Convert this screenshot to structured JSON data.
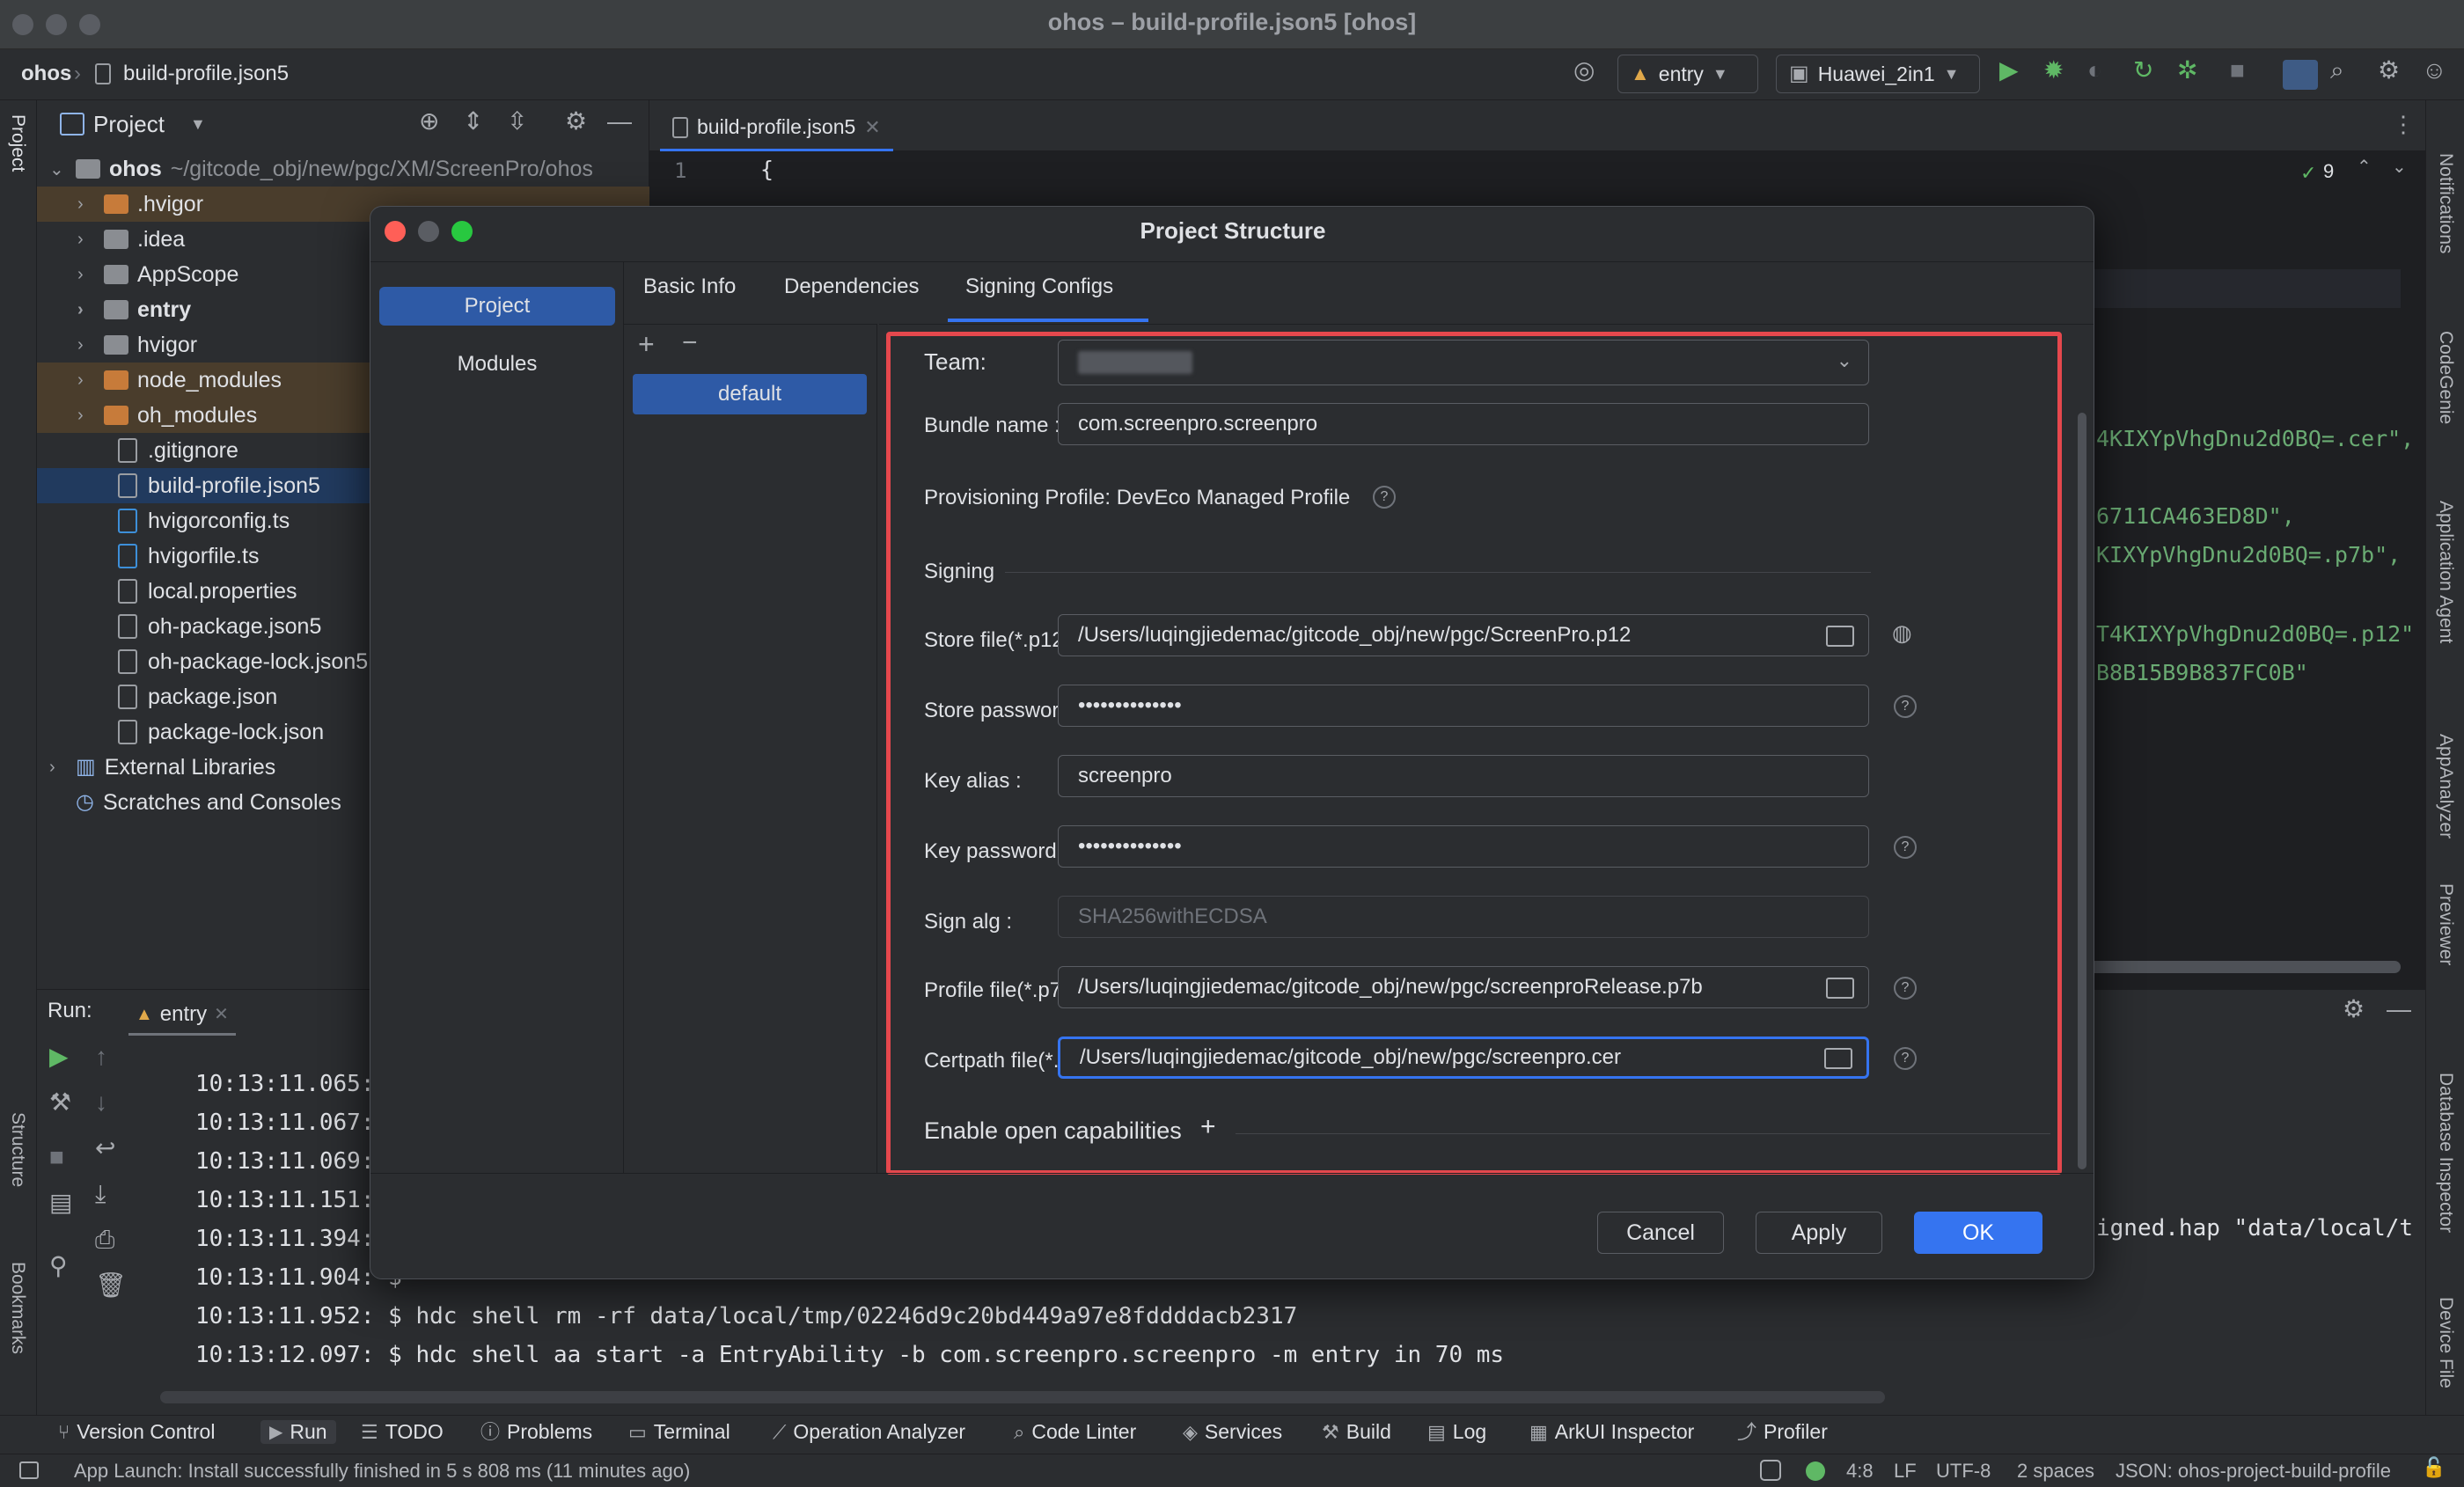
{
  "window": {
    "title": "ohos – build-profile.json5 [ohos]"
  },
  "breadcrumb": {
    "project": "ohos",
    "file": "build-profile.json5"
  },
  "toolbar": {
    "run_config": "entry",
    "device": "Huawei_2in1"
  },
  "project_panel": {
    "title": "Project",
    "root_name": "ohos",
    "root_path": "~/gitcode_obj/new/pgc/XM/ScreenPro/ohos",
    "items": [
      {
        "label": ".hvigor"
      },
      {
        "label": ".idea"
      },
      {
        "label": "AppScope"
      },
      {
        "label": "entry"
      },
      {
        "label": "hvigor"
      },
      {
        "label": "node_modules"
      },
      {
        "label": "oh_modules"
      },
      {
        "label": ".gitignore"
      },
      {
        "label": "build-profile.json5"
      },
      {
        "label": "hvigorconfig.ts"
      },
      {
        "label": "hvigorfile.ts"
      },
      {
        "label": "local.properties"
      },
      {
        "label": "oh-package.json5"
      },
      {
        "label": "oh-package-lock.json5"
      },
      {
        "label": "package.json"
      },
      {
        "label": "package-lock.json"
      },
      {
        "label": "External Libraries"
      },
      {
        "label": "Scratches and Consoles"
      }
    ]
  },
  "editor": {
    "tab": "build-profile.json5",
    "line_number": "1",
    "first_line": "{",
    "problems_count": "9",
    "visible_fragments": [
      "4KIXYpVhgDnu2d0BQ=.cer\",",
      "6711CA463ED8D\",",
      "KIXYpVhgDnu2d0BQ=.p7b\",",
      "T4KIXYpVhgDnu2d0BQ=.p12\"",
      "B8B15B9B837FC0B\""
    ]
  },
  "run_panel": {
    "label": "Run:",
    "tab": "entry",
    "logs": [
      "10:13:11.065: Bu",
      "10:13:11.067: La",
      "10:13:11.069: $",
      "10:13:11.151: $",
      "10:13:11.394: $",
      "10:13:11.904: $",
      "10:13:11.952: $ hdc shell rm -rf data/local/tmp/02246d9c20bd449a97e8fddddacb2317",
      "10:13:12.097: $ hdc shell aa start -a EntryAbility -b com.screenpro.screenpro -m entry in 70 ms"
    ],
    "right_fragment": "igned.hap \"data/local/t"
  },
  "dialog": {
    "title": "Project Structure",
    "sidebar": [
      "Project",
      "Modules"
    ],
    "tabs": [
      "Basic Info",
      "Dependencies",
      "Signing Configs"
    ],
    "configs": [
      "default"
    ],
    "form": {
      "team_label": "Team:",
      "bundle_label": "Bundle name :",
      "bundle_value": "com.screenpro.screenpro",
      "provisioning": "Provisioning Profile: DevEco Managed Profile",
      "signing_section": "Signing",
      "store_file_label": "Store file(*.p12) :",
      "store_file_value": "/Users/luqingjiedemac/gitcode_obj/new/pgc/ScreenPro.p12",
      "store_password_label": "Store password :",
      "store_password_value": "••••••••••••••",
      "key_alias_label": "Key alias :",
      "key_alias_value": "screenpro",
      "key_password_label": "Key password :",
      "key_password_value": "••••••••••••••",
      "sign_alg_label": "Sign alg :",
      "sign_alg_value": "SHA256withECDSA",
      "profile_file_label": "Profile file(*.p7b) :",
      "profile_file_value": "/Users/luqingjiedemac/gitcode_obj/new/pgc/screenproRelease.p7b",
      "certpath_label": "Certpath file(*.cer) :",
      "certpath_value": "/Users/luqingjiedemac/gitcode_obj/new/pgc/screenpro.cer",
      "open_capabilities": "Enable open capabilities"
    },
    "buttons": {
      "cancel": "Cancel",
      "apply": "Apply",
      "ok": "OK"
    }
  },
  "tool_windows": [
    "Version Control",
    "Run",
    "TODO",
    "Problems",
    "Terminal",
    "Operation Analyzer",
    "Code Linter",
    "Services",
    "Build",
    "Log",
    "ArkUI Inspector",
    "Profiler"
  ],
  "right_strip": [
    "Notifications",
    "CodeGenie",
    "Application Agent",
    "AppAnalyzer",
    "Previewer",
    "Database Inspector",
    "Device File"
  ],
  "left_strip": [
    "Project",
    "Structure",
    "Bookmarks"
  ],
  "status": {
    "message": "App Launch: Install successfully finished in 5 s 808 ms (11 minutes ago)",
    "position": "4:8",
    "line_sep": "LF",
    "encoding": "UTF-8",
    "indent": "2 spaces",
    "schema": "JSON: ohos-project-build-profile"
  },
  "colors": {
    "accent": "#3574f0",
    "highlight": "#e5484d",
    "selection": "#2e5aa6"
  }
}
